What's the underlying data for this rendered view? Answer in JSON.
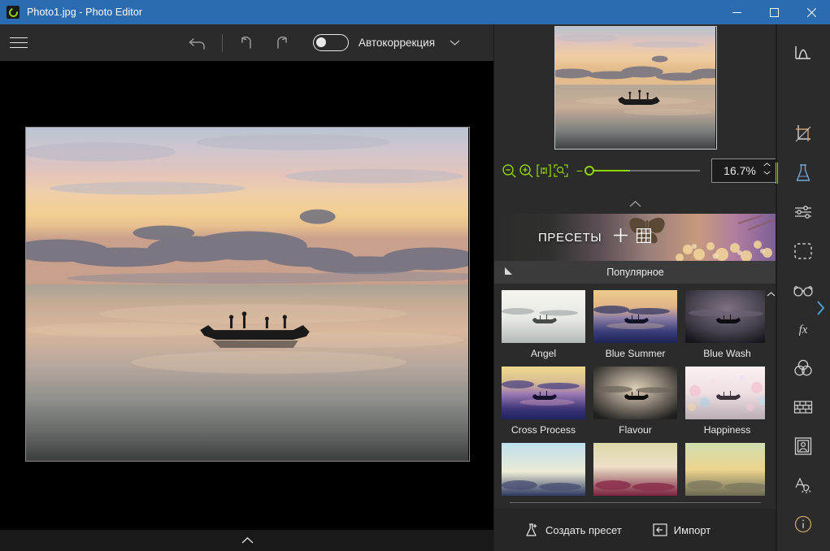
{
  "window": {
    "title": "Photo1.jpg - Photo Editor",
    "app_icon": "photo-editor-logo-icon",
    "minimize_label": "Minimize",
    "maximize_label": "Maximize",
    "close_label": "Close"
  },
  "toolbar": {
    "menu_label": "Menu",
    "reset_label": "Reset",
    "undo_label": "Undo",
    "redo_label": "Redo",
    "autocorrect_label": "Автокоррекция",
    "autocorrect_enabled": false,
    "autocorrect_dropdown_label": "Параметры автокоррекции"
  },
  "canvas": {
    "image_name": "Photo1.jpg",
    "collapse_label": "Свернуть"
  },
  "preview": {
    "collapse_label": "Свернуть"
  },
  "zoom": {
    "zoom_out_label": "Уменьшить",
    "zoom_in_label": "Увеличить",
    "actual_size_label": "1:1",
    "fit_label": "По размеру окна",
    "value": "16.7%",
    "slider_percent": 39,
    "minus_label": "−"
  },
  "presets": {
    "header_title": "ПРЕСЕТЫ",
    "add_label": "Добавить",
    "grid_label": "Сетка",
    "category": "Популярное",
    "category_collapse_label": "Свернуть категорию",
    "scroll_up_label": "Вверх",
    "scroll_down_label": "Вниз",
    "items": [
      {
        "label": "Angel",
        "c1": "#f2efe8",
        "c2": "#dfe3e0",
        "c3": "#b9bfbd",
        "sky": "#f7f5ef"
      },
      {
        "label": "Blue Summer",
        "c1": "#e8c489",
        "c2": "#6d6f9a",
        "c3": "#1b2356",
        "sky": "#efcb8e"
      },
      {
        "label": "Blue Wash",
        "c1": "#4a4a52",
        "c2": "#7b6d84",
        "c3": "#1b1b22",
        "sky": "#55555f"
      },
      {
        "label": "Cross Process",
        "c1": "#ecd98a",
        "c2": "#9e7cb4",
        "c3": "#1f2460",
        "sky": "#efd98c"
      },
      {
        "label": "Flavour",
        "c1": "#3a3a38",
        "c2": "#d8cbb4",
        "c3": "#22221f",
        "sky": "#45433e"
      },
      {
        "label": "Happiness",
        "c1": "#f6e8ec",
        "c2": "#e9d6dd",
        "c3": "#c7b6bd",
        "sky": "#faf0f2"
      }
    ],
    "partial_items": [
      {
        "label": "",
        "c1": "#bfe0ef",
        "c2": "#e9e3cf",
        "c3": "#2e3a63"
      },
      {
        "label": "",
        "c1": "#ddd9a8",
        "c2": "#cf8aa2",
        "c3": "#7a2440"
      },
      {
        "label": "",
        "c1": "#cfe0b0",
        "c2": "#edd48f",
        "c3": "#6b6a52"
      }
    ],
    "create_preset_label": "Создать пресет",
    "import_label": "Импорт"
  },
  "rail": {
    "items": [
      {
        "name": "histogram",
        "label": "Гистограмма",
        "active": false
      },
      {
        "name": "crop",
        "label": "Кадрирование",
        "active": false
      },
      {
        "name": "presets",
        "label": "Пресеты",
        "active": true
      },
      {
        "name": "adjust",
        "label": "Коррекция",
        "active": false
      },
      {
        "name": "selection",
        "label": "Выделение",
        "active": false
      },
      {
        "name": "denoise",
        "label": "Резкость",
        "active": false
      },
      {
        "name": "effects",
        "label": "Эффекты",
        "active": false
      },
      {
        "name": "color",
        "label": "Цвет",
        "active": false
      },
      {
        "name": "texture",
        "label": "Текстуры",
        "active": false
      },
      {
        "name": "frames",
        "label": "Рамки",
        "active": false
      },
      {
        "name": "text",
        "label": "Текст",
        "active": false
      },
      {
        "name": "info",
        "label": "Информация",
        "active": false
      }
    ],
    "expand_label": "Развернуть панель"
  },
  "colors": {
    "titlebar": "#2b6cb0",
    "accent_green": "#8fd400",
    "panel_bg": "#2b2b2b",
    "canvas_bg": "#000000",
    "text": "#e9e9e9"
  }
}
